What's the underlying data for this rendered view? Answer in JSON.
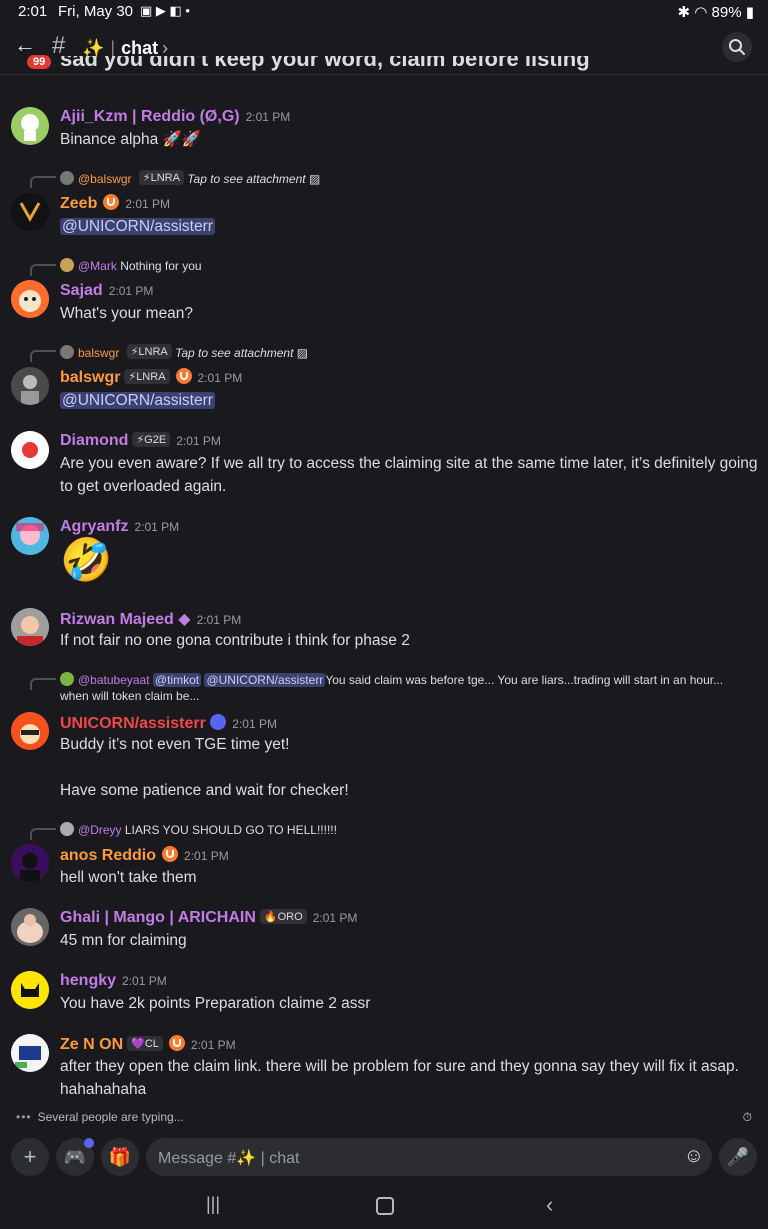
{
  "status": {
    "time": "2:01",
    "date": "Fri, May 30",
    "battery": "89%"
  },
  "header": {
    "badge": "99",
    "channel_emoji": "✨",
    "channel_name": "chat",
    "cutoff_text": "sad you didn't keep your word, claim before listing"
  },
  "messages": [
    {
      "author": "Ajii_Kzm | Reddio (Ø,G)",
      "time": "2:01 PM",
      "text": "Binance alpha 🚀🚀",
      "color": "#c27ce6"
    },
    {
      "reply_name": "@balswgr",
      "reply_tag": "⚡LNRA",
      "reply_text": "Tap to see attachment",
      "author": "Zeeb",
      "time": "2:01 PM",
      "mention": "@UNICORN/assisterr",
      "color": "#ff9a3c"
    },
    {
      "reply_name": "@Mark",
      "reply_text": "Nothing for you",
      "author": "Sajad",
      "time": "2:01 PM",
      "text": "What's your mean?",
      "color": "#c27ce6"
    },
    {
      "reply_name": "balswgr",
      "reply_tag": "⚡LNRA",
      "reply_text": "Tap to see attachment",
      "author": "balswgr",
      "tag": "⚡LNRA",
      "time": "2:01 PM",
      "mention": "@UNICORN/assisterr",
      "color": "#ff9a3c"
    },
    {
      "author": "Diamond",
      "tag": "⚡G2E",
      "time": "2:01 PM",
      "text": "Are you even aware? If we all try to access the claiming site at the same time later, it’s definitely going to get overloaded again.",
      "color": "#c27ce6"
    },
    {
      "author": "Agryanfz",
      "time": "2:01 PM",
      "text": "🤣",
      "color": "#c27ce6"
    },
    {
      "author": "Rizwan Majeed",
      "time": "2:01 PM",
      "text": "If not fair no one gona contribute i think for phase 2",
      "color": "#c27ce6"
    },
    {
      "reply_name": "@batubeyaat",
      "reply_m1": "@timkot",
      "reply_m2": "@UNICORN/assisterr",
      "reply_text": "You said claim was before tge... You are liars...trading will start in an hour... when will token claim be...",
      "author": "UNICORN/assisterr",
      "time": "2:01 PM",
      "text": "Buddy it’s not even TGE time yet!",
      "text2": "Have some patience and wait for checker!",
      "color": "#f04747"
    },
    {
      "reply_name": "@Dreyy",
      "reply_text": "LIARS YOU SHOULD GO TO HELL!!!!!!",
      "author": "anos Reddio",
      "time": "2:01 PM",
      "text": "hell won't take them",
      "color": "#ff9a3c"
    },
    {
      "author": "Ghali | Mango | ARICHAIN",
      "tag": "🔥ORO",
      "time": "2:01 PM",
      "text": "45 mn for claiming",
      "color": "#c27ce6"
    },
    {
      "author": "hengky",
      "time": "2:01 PM",
      "text": "You have 2k points Preparation claime 2 assr",
      "color": "#c27ce6"
    },
    {
      "author": "Ze N ON",
      "tag": "💜CL",
      "time": "2:01 PM",
      "text": "after they open the claim link. there will be problem for sure and they gonna say they will fix it asap. hahahahaha",
      "color": "#ff9a3c"
    }
  ],
  "typing": "Several people are typing...",
  "composer": {
    "placeholder": "Message #✨ | chat"
  }
}
